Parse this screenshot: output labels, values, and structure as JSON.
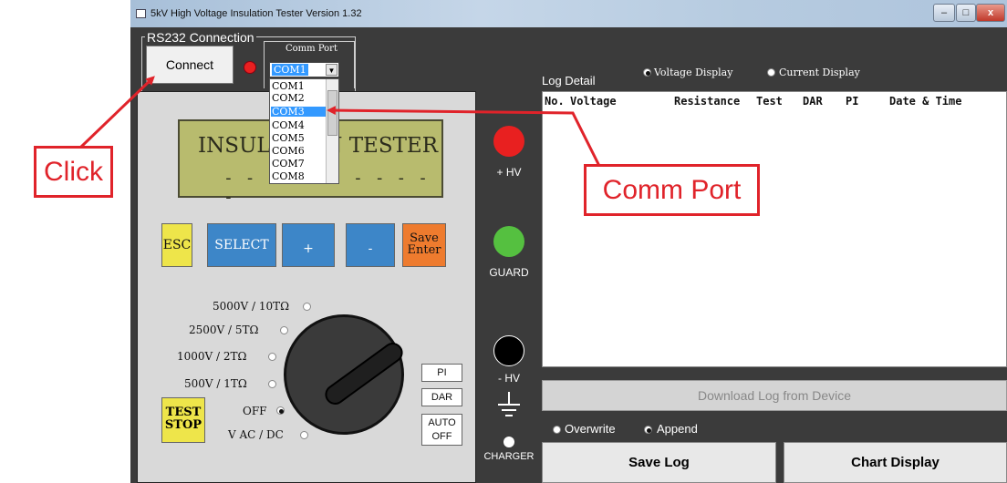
{
  "window": {
    "title": "5kV High Voltage Insulation Tester  Version 1.32",
    "controls": [
      "–",
      "□",
      "x"
    ]
  },
  "rs232": {
    "group_label": "RS232 Connection",
    "connect_label": "Connect",
    "comm_port_label": "Comm Port",
    "selected_port": "COM1",
    "port_options": [
      "COM1",
      "COM2",
      "COM3",
      "COM4",
      "COM5",
      "COM6",
      "COM7",
      "COM8"
    ],
    "highlighted_option": "COM3",
    "status_led_color": "#e82020"
  },
  "panel": {
    "display_title": "INSULATION TESTER",
    "display_dashes": "- - - - - - - - - - -",
    "keys": {
      "esc": "ESC",
      "select": "SELECT",
      "plus": "+",
      "minus": "-",
      "save": "Save",
      "enter": "Enter"
    },
    "ranges": [
      {
        "label": "5000V / 10TΩ",
        "selected": false
      },
      {
        "label": "2500V / 5TΩ",
        "selected": false
      },
      {
        "label": "1000V / 2TΩ",
        "selected": false
      },
      {
        "label": "500V / 1TΩ",
        "selected": false
      },
      {
        "label": "OFF",
        "selected": true
      },
      {
        "label": "V AC / DC",
        "selected": false
      }
    ],
    "side_buttons": {
      "pi": "PI",
      "dar": "DAR",
      "auto": "AUTO",
      "off": "OFF"
    },
    "test_stop": {
      "line1": "TEST",
      "line2": "STOP"
    }
  },
  "terminals": {
    "hv_plus": {
      "label": "+ HV",
      "color": "#e82020"
    },
    "guard": {
      "label": "GUARD",
      "color": "#55c040"
    },
    "hv_minus": {
      "label": "- HV",
      "color": "#000000"
    },
    "charger": {
      "label": "CHARGER",
      "color": "#ffffff"
    }
  },
  "log": {
    "title": "Log Detail",
    "display_options": [
      {
        "label": "Voltage Display",
        "selected": true
      },
      {
        "label": "Current Display",
        "selected": false
      }
    ],
    "columns": [
      "No.",
      "Voltage",
      "Resistance",
      "Test",
      "DAR",
      "PI",
      "Date & Time"
    ],
    "download_label": "Download Log from Device",
    "write_options": [
      {
        "label": "Overwrite",
        "selected": false
      },
      {
        "label": "Append",
        "selected": true
      }
    ],
    "save_log_label": "Save Log",
    "chart_display_label": "Chart Display"
  },
  "annotations": {
    "click_label": "Click",
    "comm_port_label": "Comm Port",
    "arrow_color": "#e0232a"
  }
}
